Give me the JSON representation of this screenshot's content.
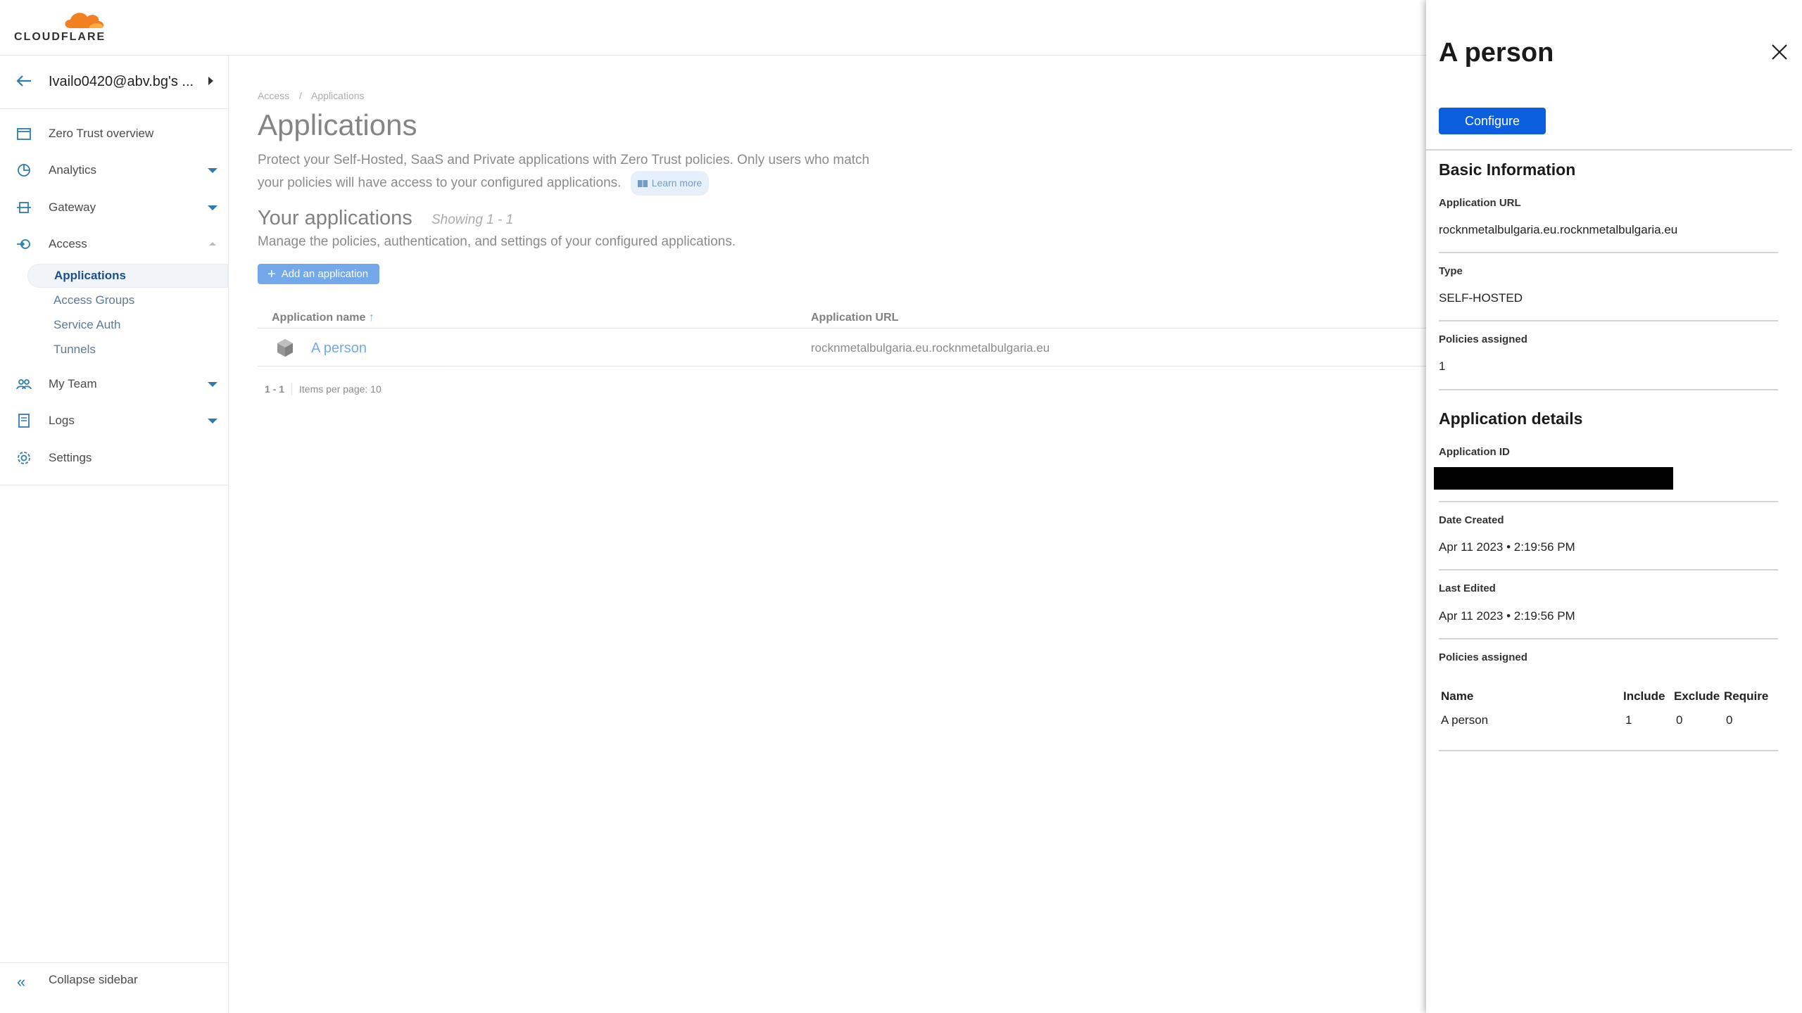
{
  "brand": {
    "name": "CLOUDFLARE",
    "accent": "#f38020"
  },
  "sidebar": {
    "account": "Ivailo0420@abv.bg's ...",
    "items": [
      {
        "label": "Zero Trust overview",
        "icon": "overview-icon"
      },
      {
        "label": "Analytics",
        "icon": "analytics-icon"
      },
      {
        "label": "Gateway",
        "icon": "gateway-icon"
      },
      {
        "label": "Access",
        "icon": "access-icon"
      },
      {
        "label": "My Team",
        "icon": "team-icon"
      },
      {
        "label": "Logs",
        "icon": "logs-icon"
      },
      {
        "label": "Settings",
        "icon": "gear-icon"
      }
    ],
    "access_sub": [
      "Applications",
      "Access Groups",
      "Service Auth",
      "Tunnels"
    ],
    "collapse": "Collapse sidebar"
  },
  "main": {
    "breadcrumb": [
      "Access",
      "/",
      "Applications"
    ],
    "title": "Applications",
    "description": "Protect your Self-Hosted, SaaS and Private applications with Zero Trust policies. Only users who match your policies will have access to your configured applications.",
    "learn_more": "Learn more",
    "section_title": "Your applications",
    "showing": "Showing 1 - 1",
    "section_sub": "Manage the policies, authentication, and settings of your configured applications.",
    "add_button": "Add an application",
    "columns": [
      "Application name",
      "Application URL"
    ],
    "rows": [
      {
        "name": "A person",
        "url": "rocknmetalbulgaria.eu.rocknmetalbulgaria.eu"
      }
    ],
    "pager": {
      "range": "1 - 1",
      "per_page": "Items per page: 10"
    }
  },
  "panel": {
    "title": "A person",
    "configure": "Configure",
    "basic_title": "Basic Information",
    "app_url_label": "Application URL",
    "app_url": "rocknmetalbulgaria.eu.rocknmetalbulgaria.eu",
    "type_label": "Type",
    "type": "SELF-HOSTED",
    "policies_label": "Policies assigned",
    "policies_count": "1",
    "details_title": "Application details",
    "app_id_label": "Application ID",
    "date_created_label": "Date Created",
    "date_created": "Apr 11 2023 • 2:19:56 PM",
    "last_edited_label": "Last Edited",
    "last_edited": "Apr 11 2023 • 2:19:56 PM",
    "policies_table_label": "Policies assigned",
    "policy_columns": [
      "Name",
      "Include",
      "Exclude",
      "Require"
    ],
    "policy_rows": [
      {
        "name": "A person",
        "include": "1",
        "exclude": "0",
        "require": "0"
      }
    ]
  }
}
